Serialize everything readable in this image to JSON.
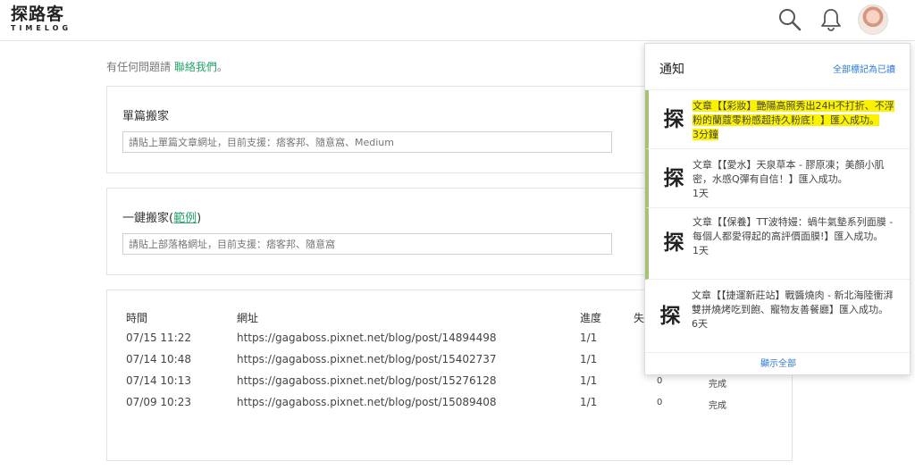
{
  "header": {
    "logo_text": "探路客",
    "logo_sub": "TIMELOG",
    "search_icon": "search-icon",
    "bell_icon": "bell-icon"
  },
  "contact": {
    "prefix": "有任何問題請",
    "link": "聯絡我們",
    "suffix": "。"
  },
  "single": {
    "title": "單篇搬家",
    "placeholder": "請貼上單篇文章網址，目前支援：痞客邦、隨意窩、Medium"
  },
  "batch": {
    "title": "一鍵搬家(",
    "example_link": "範例",
    "title_end": ")",
    "placeholder": "請貼上部落格網址，目前支援：痞客邦、隨意窩"
  },
  "table": {
    "headers": {
      "time": "時間",
      "url": "網址",
      "progress": "進度",
      "failed": "失"
    },
    "rows": [
      {
        "time": "07/15 11:22",
        "url": "https://gagaboss.pixnet.net/blog/post/14894498",
        "progress": "1/1",
        "failed": "",
        "status": ""
      },
      {
        "time": "07/14 10:48",
        "url": "https://gagaboss.pixnet.net/blog/post/15402737",
        "progress": "1/1",
        "failed": "",
        "status": ""
      },
      {
        "time": "07/14 10:13",
        "url": "https://gagaboss.pixnet.net/blog/post/15276128",
        "progress": "1/1",
        "failed": "0",
        "status": "完成"
      },
      {
        "time": "07/09 10:23",
        "url": "https://gagaboss.pixnet.net/blog/post/15089408",
        "progress": "1/1",
        "failed": "0",
        "status": "完成"
      }
    ]
  },
  "notifications": {
    "title": "通知",
    "mark_all": "全部標記為已讀",
    "show_all": "顯示全部",
    "logo_char": "探",
    "items": [
      {
        "text": "文章【【彩妝】艷陽高照秀出24H不打折、不浮粉的蘭蔻零粉感超持久粉底！】匯入成功。",
        "time": "3分鐘"
      },
      {
        "text": "文章【【愛水】天泉草本 - 膠原凍；美顏小肌密，水感Q彈有自信！】匯入成功。",
        "time": "1天"
      },
      {
        "text": "文章【【保養】TT波特嫚：蝸牛氣墊系列面膜 - 每個人都愛得起的高評價面膜!】匯入成功。",
        "time": "1天"
      },
      {
        "text": "文章【【捷運新莊站】戰醬燒肉 - 新北海陸衝湃雙拼燒烤吃到飽、寵物友善餐廳】匯入成功。",
        "time": "6天"
      }
    ]
  },
  "colors": {
    "accent_green": "#27a36b",
    "link_blue": "#2f7ad1",
    "highlight": "#fbf200",
    "unread_bar": "#a5c273"
  }
}
